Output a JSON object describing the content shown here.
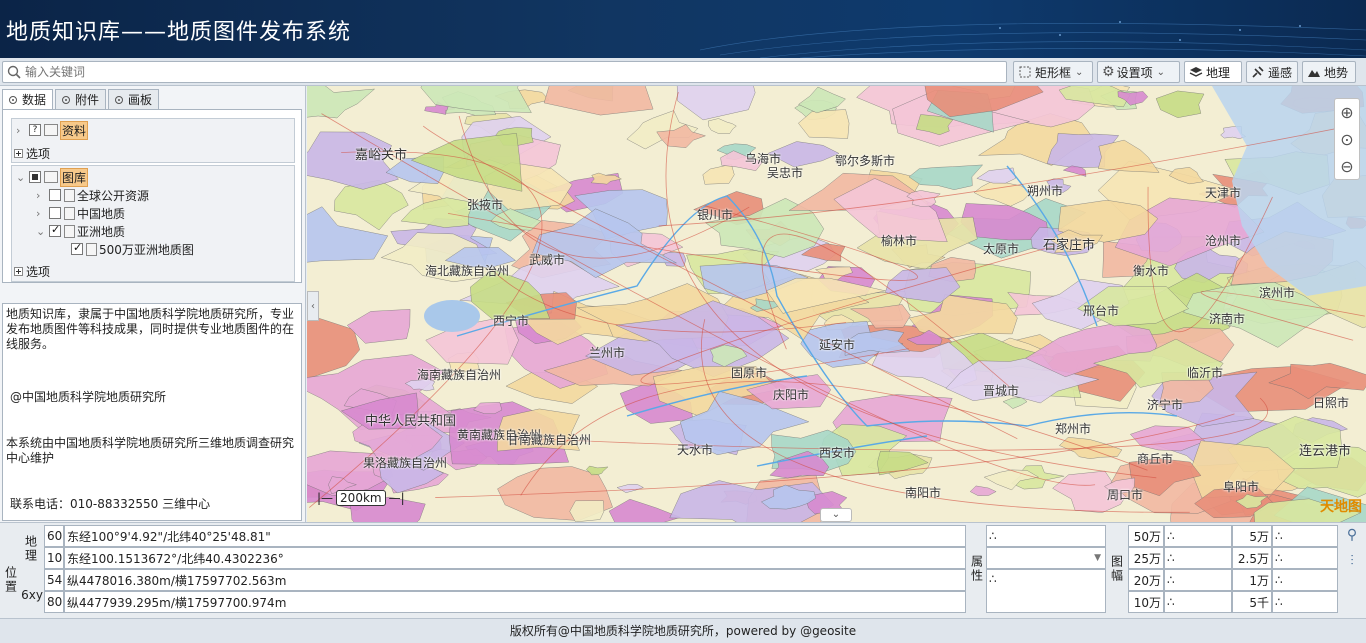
{
  "header": {
    "title": "地质知识库——地质图件发布系统"
  },
  "toolbar": {
    "search_placeholder": "输入关键词",
    "rect_btn": "矩形框",
    "settings_btn": "设置项",
    "tab_geo": "地理",
    "tab_rs": "遥感",
    "tab_terrain": "地势"
  },
  "left": {
    "tabs": [
      "数据",
      "附件",
      "画板"
    ],
    "tree": {
      "zl_label": "资料",
      "opt1": "选项",
      "tk_label": "图库",
      "items": [
        "全球公开资源",
        "中国地质",
        "亚洲地质"
      ],
      "sub_item": "500万亚洲地质图",
      "opt2": "选项"
    },
    "info": {
      "p1": "地质知识库，隶属于中国地质科学院地质研究所，专业发布地质图件等科技成果，同时提供专业地质图件的在线服务。",
      "p2": "@中国地质科学院地质研究所",
      "p3": "本系统由中国地质科学院地质研究所三维地质调查研究中心维护",
      "p4": "联系电话：010-88332550 三维中心"
    }
  },
  "map": {
    "scale_label": "200km",
    "logo": "天地图",
    "cities": [
      {
        "name": "嘉峪关市"
      },
      {
        "name": "张掖市"
      },
      {
        "name": "武威市"
      },
      {
        "name": "海北藏族自治州"
      },
      {
        "name": "西宁市"
      },
      {
        "name": "兰州市"
      },
      {
        "name": "海南藏族自治州"
      },
      {
        "name": "黄南藏族自治州"
      },
      {
        "name": "甘南藏族自治州"
      },
      {
        "name": "果洛藏族自治州"
      },
      {
        "name": "中华人民共和国"
      },
      {
        "name": "天水市"
      },
      {
        "name": "固原市"
      },
      {
        "name": "庆阳市"
      },
      {
        "name": "银川市"
      },
      {
        "name": "吴忠市"
      },
      {
        "name": "鄂尔多斯市"
      },
      {
        "name": "榆林市"
      },
      {
        "name": "延安市"
      },
      {
        "name": "西安市"
      },
      {
        "name": "太原市"
      },
      {
        "name": "石家庄市"
      },
      {
        "name": "天津市"
      },
      {
        "name": "沧州市"
      },
      {
        "name": "衡水市"
      },
      {
        "name": "邢台市"
      },
      {
        "name": "济南市"
      },
      {
        "name": "滨州市"
      },
      {
        "name": "郑州市"
      },
      {
        "name": "日照市"
      },
      {
        "name": "连云港市"
      },
      {
        "name": "商丘市"
      },
      {
        "name": "周口市"
      },
      {
        "name": "临沂市"
      },
      {
        "name": "晋城市"
      },
      {
        "name": "乌海市"
      },
      {
        "name": "朔州市"
      },
      {
        "name": "南阳市"
      },
      {
        "name": "济宁市"
      },
      {
        "name": "阜阳市"
      }
    ]
  },
  "status": {
    "pos_label": "位置",
    "geo_label": "地理",
    "xy_label": "6xy",
    "rows": [
      {
        "code": "60",
        "value": "东经100°9'4.92\"/北纬40°25'48.81\""
      },
      {
        "code": "10",
        "value": "东经100.1513672°/北纬40.4302236°"
      },
      {
        "code": "54",
        "value": "纵4478016.380m/横17597702.563m"
      },
      {
        "code": "80",
        "value": "纵4477939.295m/横17597700.974m"
      }
    ],
    "attr_label": "属性",
    "attr_dots": "∴",
    "sheet_label": "图幅",
    "scales_left": [
      "50万",
      "25万",
      "20万",
      "10万"
    ],
    "scales_right": [
      "5万",
      "2.5万",
      "1万",
      "5千"
    ],
    "dots": "∴"
  },
  "footer": {
    "text": "版权所有@中国地质科学院地质研究所，powered by @geosite"
  },
  "colors": {
    "header": "#0e3a6d",
    "accent_highlight": "#f7c98a"
  }
}
